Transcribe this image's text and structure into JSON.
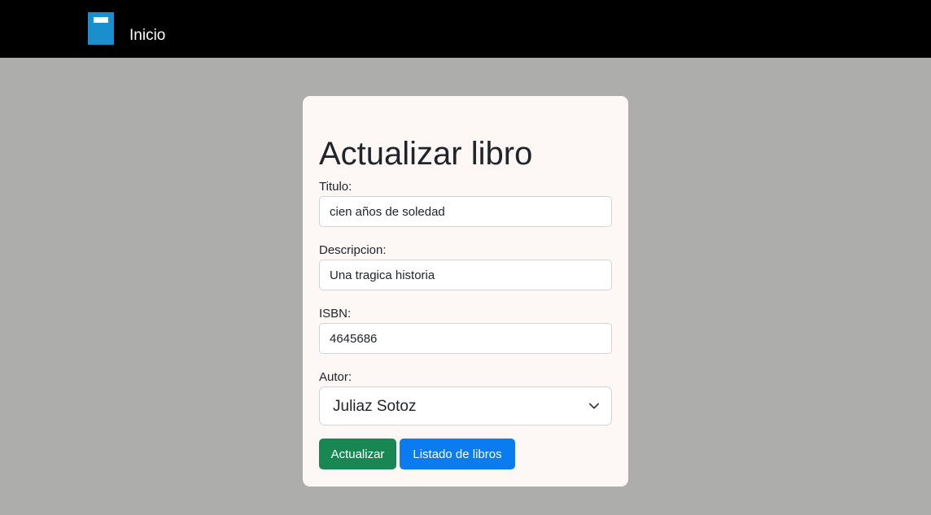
{
  "navbar": {
    "brand_icon": "book-icon",
    "link_label": "Inicio",
    "background": "#000000",
    "icon_color": "#1a8fce"
  },
  "form": {
    "heading": "Actualizar libro",
    "titulo": {
      "label": "Titulo:",
      "value": "cien años de soledad"
    },
    "descripcion": {
      "label": "Descripcion:",
      "value": "Una tragica historia"
    },
    "isbn": {
      "label": "ISBN:",
      "value": "4645686"
    },
    "autor": {
      "label": "Autor:",
      "selected": "Juliaz Sotoz",
      "icon": "chevron-down-icon"
    },
    "buttons": {
      "update_label": "Actualizar",
      "list_label": "Listado de libros"
    }
  },
  "colors": {
    "page_background": "#adadab",
    "card_background": "#fdf7f6",
    "success": "#198754",
    "primary": "#0b7bf0"
  }
}
